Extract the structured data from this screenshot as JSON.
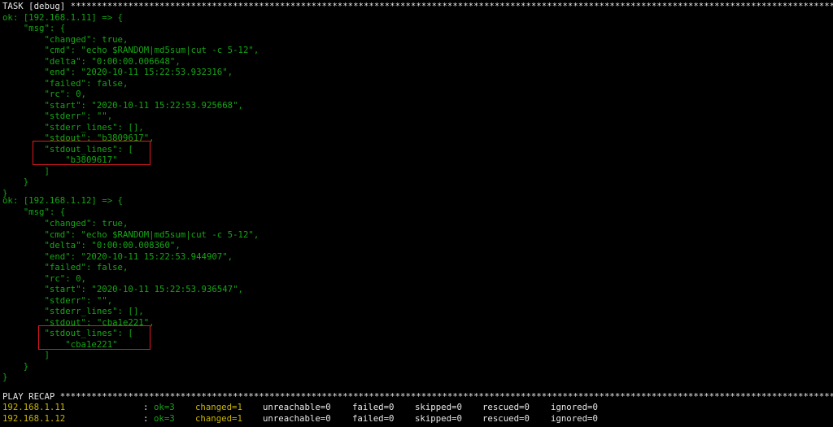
{
  "task_header": "TASK [debug] ******************************************************************************************************************************************************************",
  "hosts": [
    {
      "ok_line": "ok: [192.168.1.11] => {",
      "msg_open": "    \"msg\": {",
      "fields": [
        "        \"changed\": true,",
        "        \"cmd\": \"echo $RANDOM|md5sum|cut -c 5-12\",",
        "        \"delta\": \"0:00:00.006648\",",
        "        \"end\": \"2020-10-11 15:22:53.932316\",",
        "        \"failed\": false,",
        "        \"rc\": 0,",
        "        \"start\": \"2020-10-11 15:22:53.925668\",",
        "        \"stderr\": \"\",",
        "        \"stderr_lines\": [],",
        "        \"stdout\": \"b3809617\",",
        "        \"stdout_lines\": [",
        "            \"b3809617\"",
        "        ]"
      ],
      "msg_close": "    }",
      "close": "}"
    },
    {
      "ok_line": "ok: [192.168.1.12] => {",
      "msg_open": "    \"msg\": {",
      "fields": [
        "        \"changed\": true,",
        "        \"cmd\": \"echo $RANDOM|md5sum|cut -c 5-12\",",
        "        \"delta\": \"0:00:00.008360\",",
        "        \"end\": \"2020-10-11 15:22:53.944907\",",
        "        \"failed\": false,",
        "        \"rc\": 0,",
        "        \"start\": \"2020-10-11 15:22:53.936547\",",
        "        \"stderr\": \"\",",
        "        \"stderr_lines\": [],",
        "        \"stdout\": \"cba1e221\",",
        "        \"stdout_lines\": [",
        "            \"cba1e221\"",
        "        ]"
      ],
      "msg_close": "    }",
      "close": "}"
    }
  ],
  "recap_header": "PLAY RECAP ******************************************************************************************************************************************************************",
  "recap": [
    {
      "host": "192.168.1.11",
      "sep": ":",
      "ok": "ok=3",
      "changed": "changed=1",
      "unreachable": "unreachable=0",
      "failed": "failed=0",
      "skipped": "skipped=0",
      "rescued": "rescued=0",
      "ignored": "ignored=0"
    },
    {
      "host": "192.168.1.12",
      "sep": ":",
      "ok": "ok=3",
      "changed": "changed=1",
      "unreachable": "unreachable=0",
      "failed": "failed=0",
      "skipped": "skipped=0",
      "rescued": "rescued=0",
      "ignored": "ignored=0"
    }
  ],
  "colors": {
    "background": "#000000",
    "header_text": "#e6e6e6",
    "ok_output": "#15a615",
    "changed": "#c8b400",
    "highlight_box": "#e0181e"
  }
}
